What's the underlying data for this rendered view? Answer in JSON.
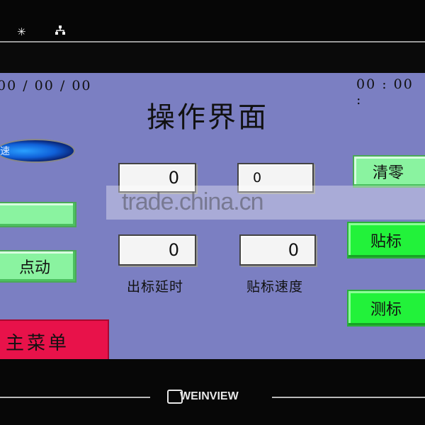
{
  "status_icons": [
    "sun-icon",
    "network-icon"
  ],
  "screen": {
    "date": "00 / 00 / 00",
    "time": "00 : 00 :",
    "title": "操作界面",
    "speed_indicator_label": "低速",
    "clear_button": "清零",
    "apply_label_button": "贴标",
    "jog_button": "点动",
    "measure_label_button": "测标",
    "main_menu_button": "主菜单",
    "top_left_value": "0",
    "top_right_value": "0",
    "label_delay_value": "0",
    "label_speed_value": "0",
    "label_delay_caption": "出标延时",
    "label_speed_caption": "贴标速度"
  },
  "watermark": "trade.china.cn",
  "brand": "WEINVIEW",
  "colors": {
    "screen_bg": "#7b7fc2",
    "green_button": "#22f23a",
    "light_green_button": "#8af3a0",
    "red_button": "#e8124a"
  }
}
